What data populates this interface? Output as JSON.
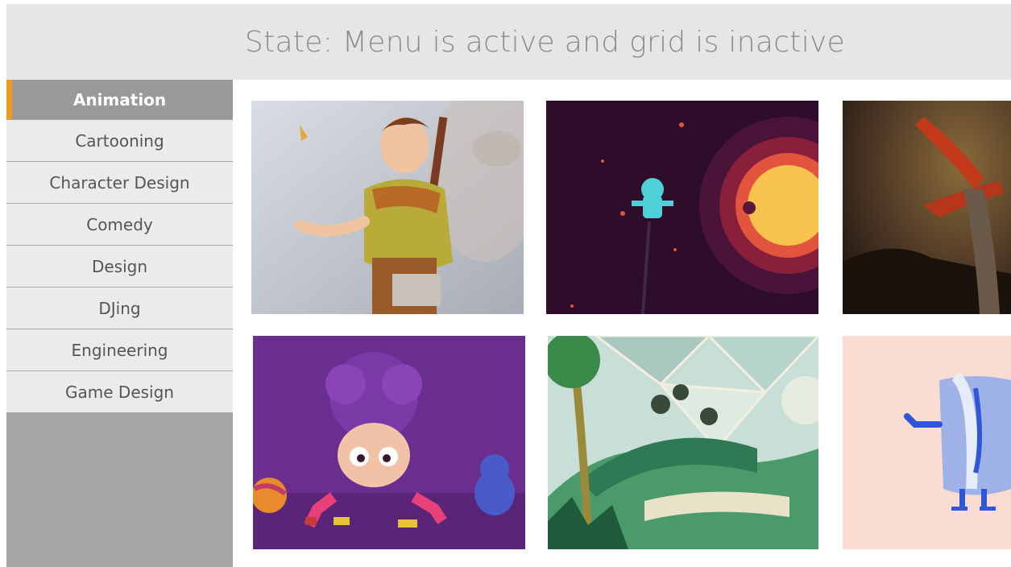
{
  "header": {
    "title": "State: Menu is active and grid is inactive"
  },
  "menu": {
    "items": [
      {
        "label": "Animation",
        "active": true
      },
      {
        "label": "Cartooning"
      },
      {
        "label": "Character Design"
      },
      {
        "label": "Comedy"
      },
      {
        "label": "Design"
      },
      {
        "label": "DJing"
      },
      {
        "label": "Engineering"
      },
      {
        "label": "Game Design"
      }
    ]
  },
  "colors": {
    "accent": "#f29a1f",
    "menu_active_bg": "#999999",
    "menu_bg": "#ebebeb",
    "header_bg": "#e6e6e6"
  },
  "grid": {
    "tiles": [
      {
        "subject": "cartoon-adventurer-character-illustration"
      },
      {
        "subject": "astronaut-floating-in-space-with-sun-illustration"
      },
      {
        "subject": "pterodactyl-creature-dark-painting"
      },
      {
        "subject": "purple-clay-kid-toy-render"
      },
      {
        "subject": "futuristic-dome-park-landscape-illustration"
      },
      {
        "subject": "blue-character-on-pink-background-illustration"
      }
    ]
  }
}
